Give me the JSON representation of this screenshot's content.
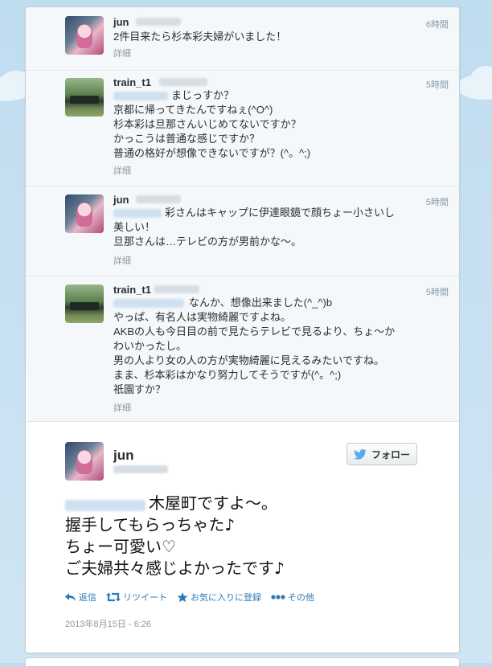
{
  "replies": [
    {
      "username": "jun",
      "time": "6時間",
      "text": "2件目来たら杉本彩夫婦がいました！",
      "detail": "詳細",
      "avatar": "jun-avatar"
    },
    {
      "username": "train_t1",
      "time": "5時間",
      "text": "まじっすか？\n京都に帰ってきたんですねぇ(^O^)\n杉本彩は旦那さんいじめてないですか？\nかっこうは普通な感じですか？\n普通の格好が想像できないですが？(^。^;)",
      "detail": "詳細",
      "avatar": "train-avatar"
    },
    {
      "username": "jun",
      "time": "5時間",
      "text": "彩さんはキャップに伊達眼鏡で顔ちょー小さいし\n美しい！\n旦那さんは…テレビの方が男前かな〜。",
      "detail": "詳細",
      "avatar": "jun-avatar"
    },
    {
      "username": "train_t1",
      "time": "5時間",
      "text": "なんか、想像出来ました(^_^)b\nやっぱ、有名人は実物綺麗ですよね。\nAKBの人も今日目の前で見たらテレビで見るより、ちょ〜か\nわいかったし。\n男の人より女の人の方が実物綺麗に見えるみたいですね。\nまま、杉本彩はかなり努力してそうですが(^。^;)\n祇園すか？",
      "detail": "詳細",
      "avatar": "train-avatar"
    }
  ],
  "main_tweet": {
    "username": "jun",
    "follow_label": "フォロー",
    "lines": [
      "木屋町ですよ〜。",
      "握手してもらっちゃた♪",
      "ちょー可愛い♡",
      "ご夫婦共々感じよかったです♪"
    ],
    "actions": {
      "reply": "返信",
      "retweet": "リツイート",
      "favorite": "お気に入りに登録",
      "more": "その他"
    },
    "timestamp": "2013年8月15日 - 6:26"
  },
  "colors": {
    "link": "#2b7bb9",
    "muted": "#8899a6",
    "text": "#292f33",
    "twitter_bird": "#55acee"
  }
}
